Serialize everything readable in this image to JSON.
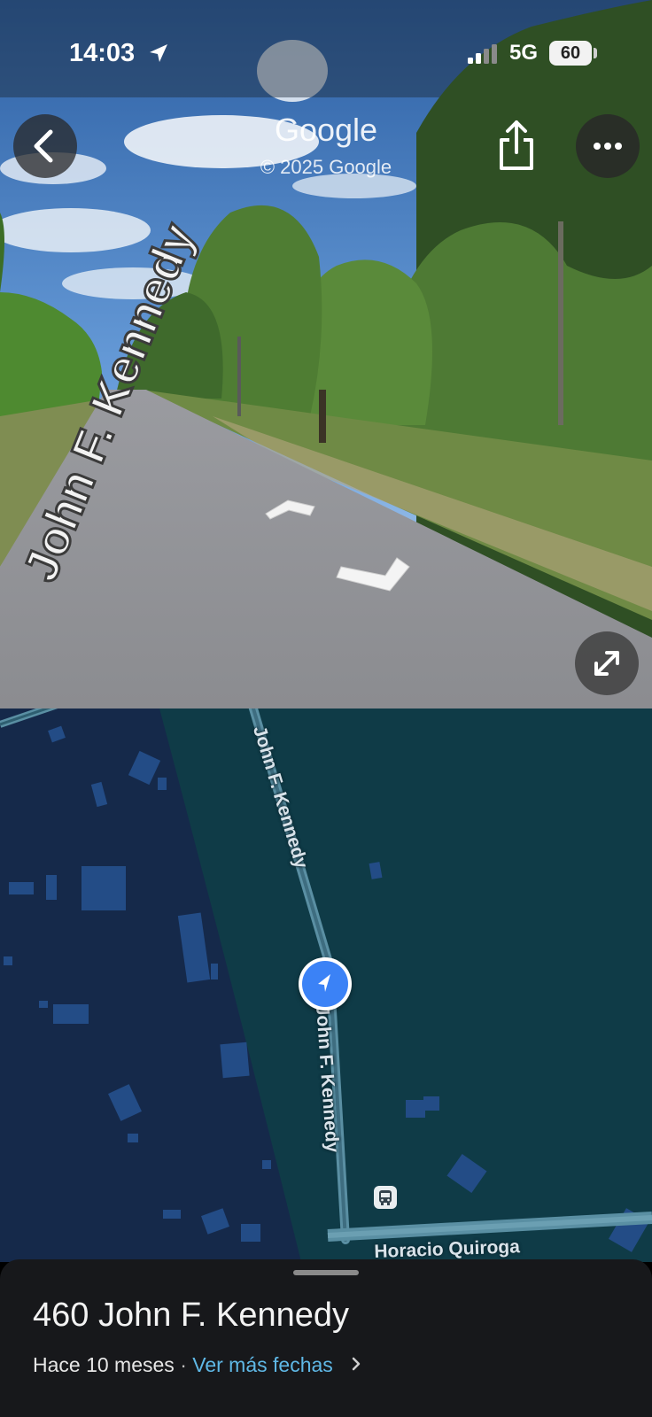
{
  "status_bar": {
    "time": "14:03",
    "network": "5G",
    "battery": "60"
  },
  "street_view": {
    "title": "Google",
    "copyright": "© 2025 Google",
    "street_label": "John F. Kennedy"
  },
  "map": {
    "roads": [
      {
        "label": "John F. Kennedy"
      },
      {
        "label": "John F. Kennedy"
      },
      {
        "label": "Horacio Quiroga"
      }
    ],
    "colors": {
      "background": "#0f3b47",
      "urban_area": "#15294a",
      "buildings": "#234c86",
      "road": "#5a8fa3"
    }
  },
  "bottom_sheet": {
    "address": "460 John F. Kennedy",
    "date_text": "Hace 10 meses",
    "separator": "·",
    "more_dates_link": "Ver más fechas",
    "link_color": "#5fb8e6"
  },
  "icons": [
    "location-arrow-icon",
    "signal-icon",
    "battery-icon",
    "back-arrow-icon",
    "share-icon",
    "more-dots-icon",
    "expand-icon",
    "bus-stop-icon",
    "navigation-arrow-icon",
    "chevron-right-icon"
  ]
}
